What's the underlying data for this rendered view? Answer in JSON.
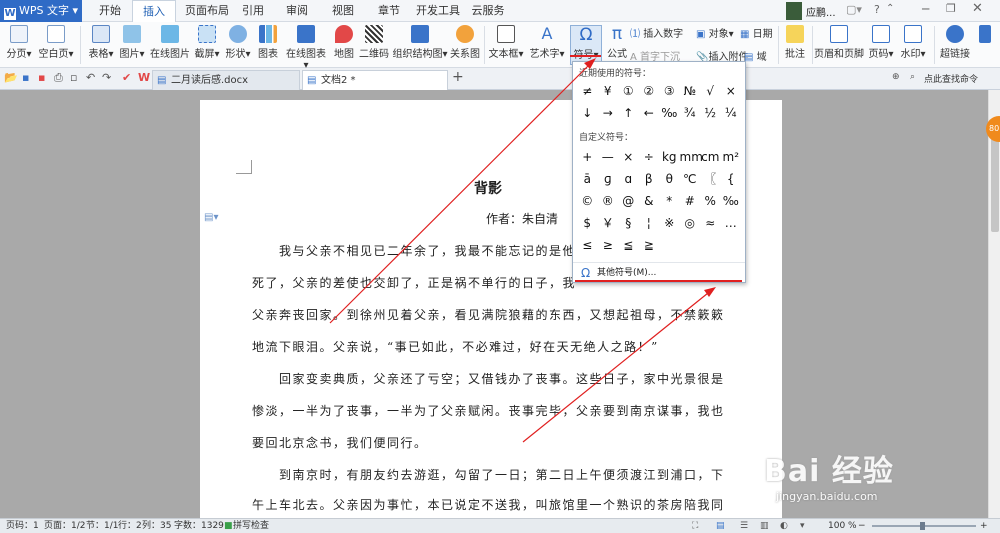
{
  "app": {
    "name": "WPS 文字"
  },
  "menu_tabs": [
    "开始",
    "插入",
    "页面布局",
    "引用",
    "审阅",
    "视图",
    "章节",
    "开发工具",
    "云服务"
  ],
  "active_tab": "插入",
  "user": {
    "name": "应鹏..."
  },
  "ribbon": {
    "page_break": "分页",
    "blank_page": "空白页",
    "table": "表格",
    "picture": "图片",
    "online_picture": "在线图片",
    "screenshot": "截屏",
    "shape": "形状",
    "chart": "图表",
    "online_chart": "在线图表",
    "map": "地图",
    "qrcode": "二维码",
    "org_chart": "组织结构图",
    "relation_chart": "关系图",
    "textbox": "文本框",
    "art_text": "艺术字",
    "symbol": "符号",
    "formula": "公式",
    "insert_number": "插入数字",
    "object": "对象",
    "date": "日期",
    "dropcap": "首字下沉",
    "insert_attachment": "插入附件",
    "field": "域",
    "comment": "批注",
    "header_footer": "页眉和页脚",
    "page_number": "页码",
    "watermark": "水印",
    "hyperlink": "超链接"
  },
  "doc_tabs": [
    {
      "label": "二月读后感.docx",
      "active": false
    },
    {
      "label": "文档2 *",
      "active": true
    }
  ],
  "quick_command": "点此查找命令",
  "symbol_panel": {
    "recent_label": "近期使用的符号：",
    "recent": [
      "≠",
      "¥",
      "①",
      "②",
      "③",
      "№",
      "√",
      "×",
      "↓",
      "→",
      "↑",
      "←",
      "‰",
      "¾",
      "½",
      "¼"
    ],
    "custom_label": "自定义符号：",
    "custom": [
      "+",
      "—",
      "×",
      "÷",
      "kg",
      "mm",
      "cm",
      "m²",
      "ā",
      "ɡ",
      "ɑ",
      "β",
      "θ",
      "℃",
      "〖",
      "{",
      "©",
      "®",
      "@",
      "&",
      "*",
      "#",
      "%",
      "‰",
      "$",
      "￥",
      "§",
      "¦",
      "※",
      "◎",
      "≈",
      "…",
      "≤",
      "≥",
      "≦",
      "≧"
    ],
    "more_label": "其他符号(M)..."
  },
  "document": {
    "title": "背影",
    "author": "作者：朱自清",
    "lines": [
      "　　我与父亲不相见已二年余了，我最不能忘记的是他",
      "死了，父亲的差使也交卸了，正是祸不单行的日子，我",
      "父亲奔丧回家。到徐州见着父亲，看见满院狼藉的东西，又想起祖母，不禁簌簌",
      "地流下眼泪。父亲说，“事已如此，不必难过，好在天无绝人之路！”",
      "　　回家变卖典质，父亲还了亏空；又借钱办了丧事。这些日子，家中光景很是",
      "惨淡，一半为了丧事，一半为了父亲赋闲。丧事完毕，父亲要到南京谋事，我也",
      "要回北京念书，我们便同行。",
      "　　到南京时，有朋友约去游逛，勾留了一日；第二日上午便须渡江到浦口，下",
      "午上车北去。父亲因为事忙，本已说定不送我，叫旅馆里一个熟识的茶房陪我同"
    ]
  },
  "status_bar": {
    "page": "页码：1",
    "pages": "页面：1/2",
    "section": "节：1/1",
    "row": "行：2",
    "col": "列：35",
    "words": "字数：1329",
    "spell": "拼写检查",
    "zoom": "100 %"
  },
  "side_badge": "80",
  "watermark": {
    "main": "Bai 经验",
    "sub": "jingyan.baidu.com"
  },
  "colors": {
    "accent": "#2f6bc6",
    "annotation": "#e02020",
    "badge": "#f08a1c"
  }
}
